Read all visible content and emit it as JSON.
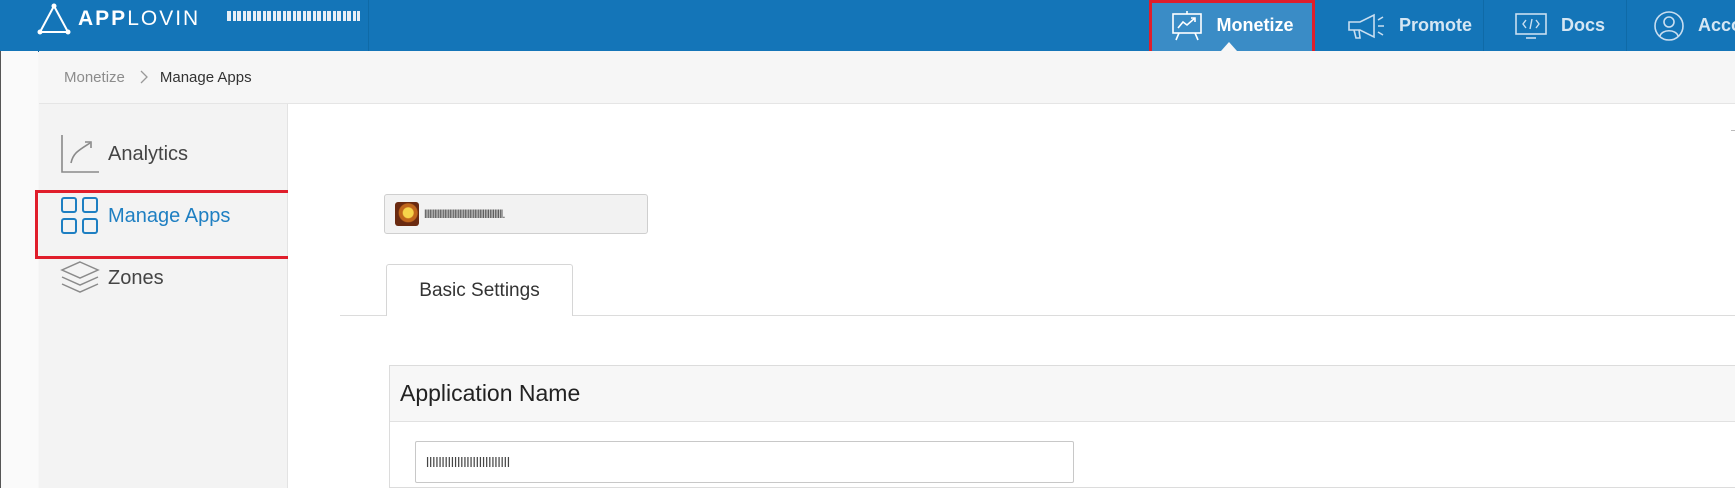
{
  "header": {
    "logo_text_bold": "APP",
    "logo_text_light": "LOVIN",
    "selected_app_label": "I ▮▮▮▮▮▮▮▮▮ ▮▮▮",
    "nav": [
      {
        "label": "Monetize",
        "icon": "presentation-chart-icon",
        "active": true
      },
      {
        "label": "Promote",
        "icon": "megaphone-icon",
        "active": false
      },
      {
        "label": "Docs",
        "icon": "code-window-icon",
        "active": false
      },
      {
        "label": "Acco",
        "icon": "user-circle-icon",
        "active": false
      }
    ]
  },
  "breadcrumb": {
    "items": [
      "Monetize",
      "Manage Apps"
    ]
  },
  "sidebar": {
    "items": [
      {
        "label": "Analytics",
        "icon": "analytics-chart-icon",
        "active": false
      },
      {
        "label": "Manage Apps",
        "icon": "grid-icon",
        "active": true
      },
      {
        "label": "Zones",
        "icon": "layers-icon",
        "active": false
      }
    ]
  },
  "main": {
    "app_selector": {
      "app_name": "lllllllllllllllllllllllllllllllllllllllllllllll."
    },
    "tabs": [
      {
        "label": "Basic Settings",
        "active": true
      }
    ],
    "section": {
      "title": "Application Name",
      "input_value": "lllllllllllllllllllllllllll"
    }
  },
  "colors": {
    "topbar": "#1475b8",
    "active_nav": "#3a8cc6",
    "accent": "#1e7fc2",
    "highlight_box": "#e01e2b"
  }
}
